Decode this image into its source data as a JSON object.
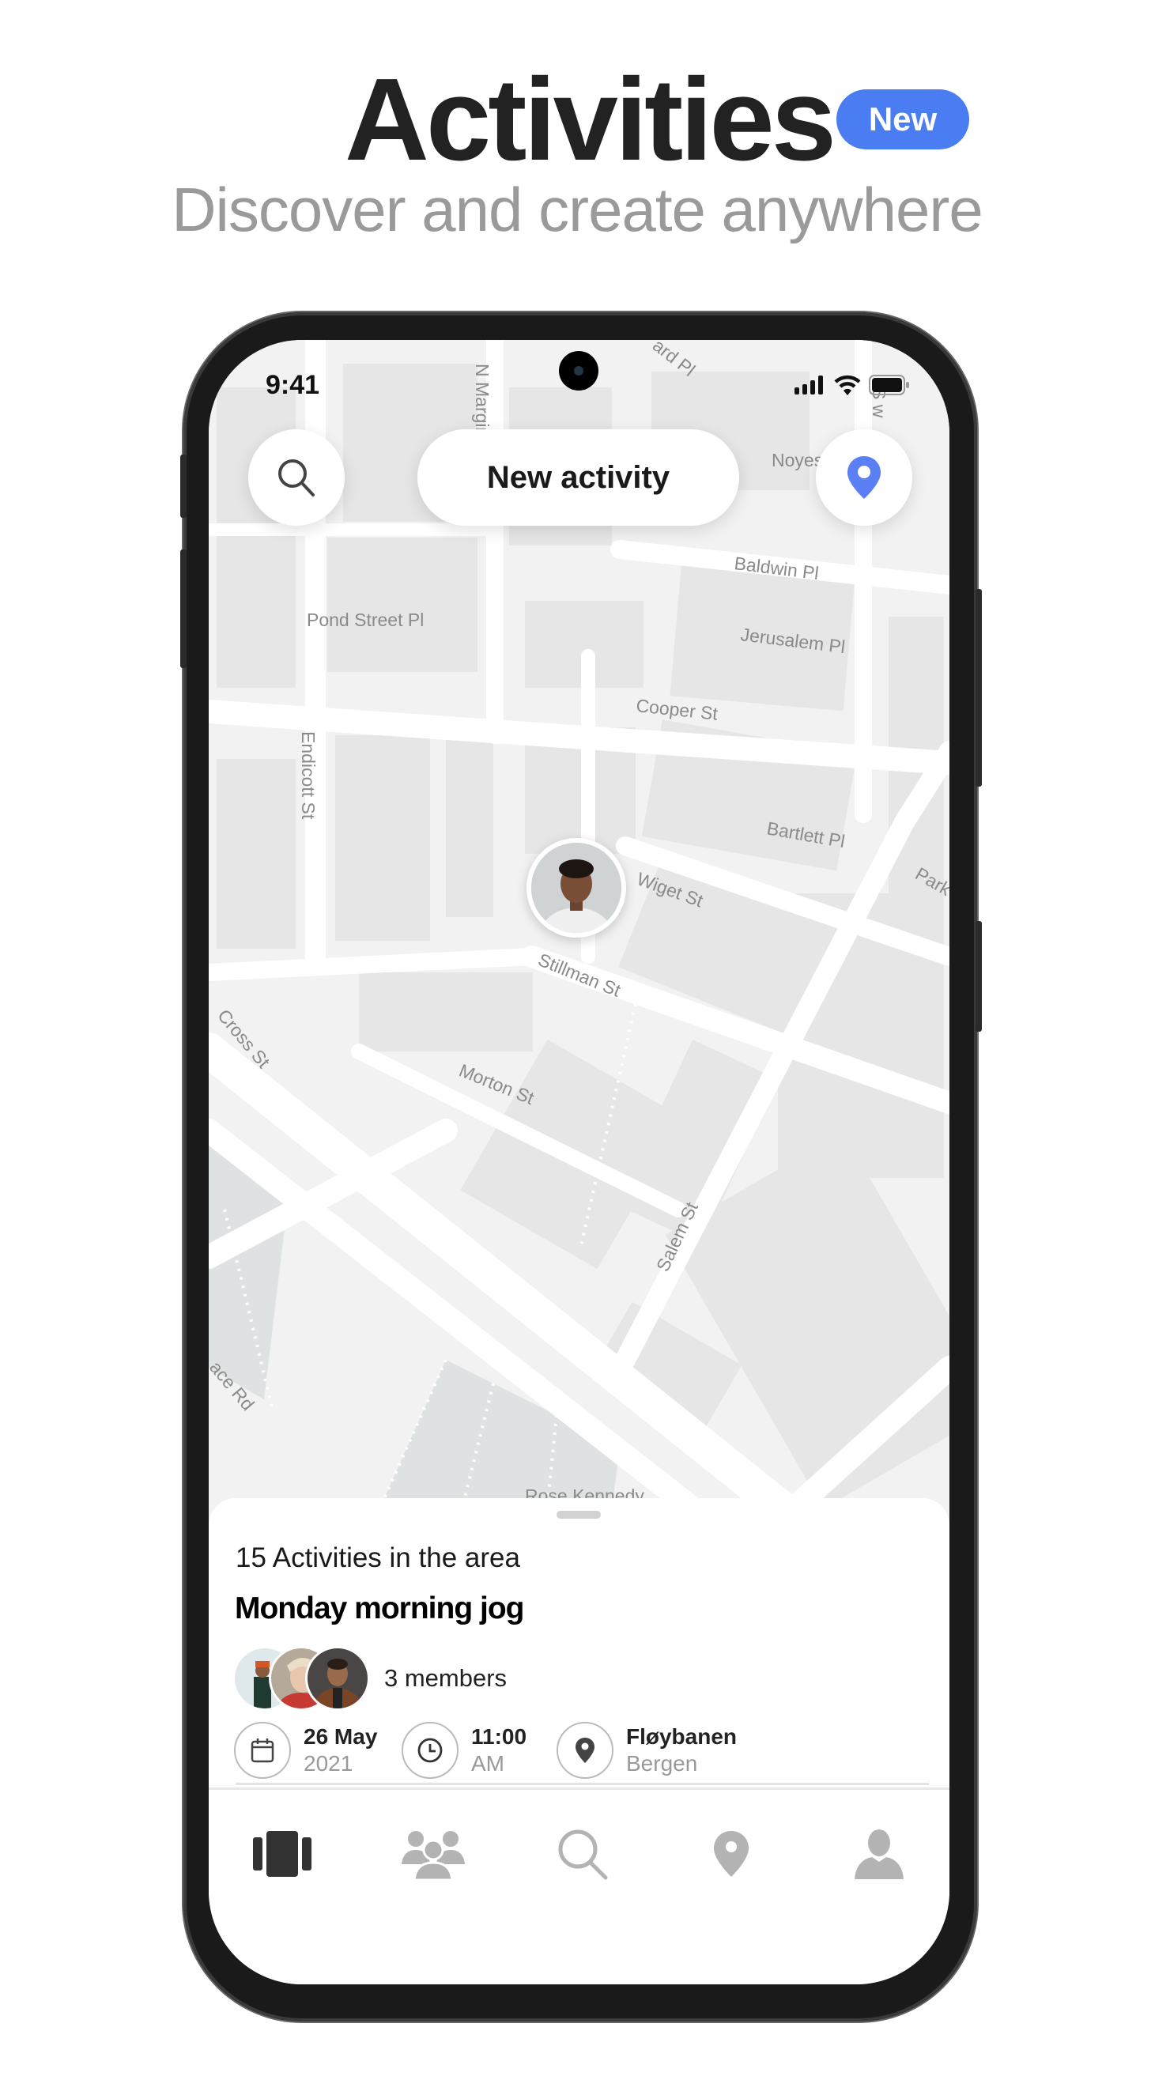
{
  "header": {
    "title": "Activities",
    "badge": "New",
    "subtitle": "Discover and create anywhere"
  },
  "colors": {
    "accent": "#4a7cf2",
    "location_pin": "#5b7ff5",
    "nav_active": "#333333",
    "nav_inactive": "#b3b3b3"
  },
  "status_bar": {
    "time": "9:41",
    "icons": [
      "signal-icon",
      "wifi-icon",
      "battery-icon"
    ]
  },
  "top_controls": {
    "search_icon": "search-icon",
    "new_activity_label": "New activity",
    "location_icon": "location-pin-icon"
  },
  "map": {
    "street_labels": [
      "N Margin",
      "ard Pl",
      "Noyes",
      "S w",
      "Baldwin Pl",
      "Pond Street Pl",
      "Jerusalem Pl",
      "Cooper St",
      "Endicott St",
      "Bartlett Pl",
      "Wiget St",
      "Park",
      "Stillman St",
      "Cross St",
      "Morton St",
      "Salem St",
      "ace Rd",
      "Rose Kennedy"
    ]
  },
  "sheet": {
    "count_label": "15 Activities in the area",
    "activity": {
      "title": "Monday morning jog",
      "members_label": "3 members",
      "date_main": "26 May",
      "date_sub": "2021",
      "time_main": "11:00",
      "time_sub": "AM",
      "place_main": "Fløybanen",
      "place_sub": "Bergen"
    }
  },
  "bottom_nav": {
    "items": [
      {
        "icon": "cards-icon",
        "active": true
      },
      {
        "icon": "group-icon",
        "active": false
      },
      {
        "icon": "search-icon",
        "active": false
      },
      {
        "icon": "location-pin-icon",
        "active": false
      },
      {
        "icon": "profile-icon",
        "active": false
      }
    ]
  }
}
